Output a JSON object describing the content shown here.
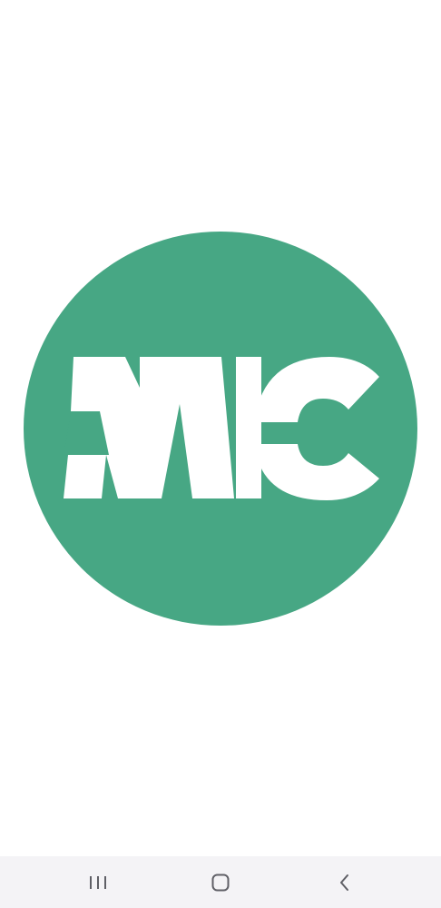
{
  "app": {
    "screen": "splash",
    "logo": {
      "icon": "mc-logo-icon",
      "lettering": "MC",
      "circle_color": "#47a784",
      "letter_color": "#ffffff"
    }
  },
  "navigation_bar": {
    "background": "#f4f3f6",
    "icon_color": "#5f5f66",
    "buttons": [
      {
        "name": "recents",
        "icon": "recents-icon"
      },
      {
        "name": "home",
        "icon": "home-icon"
      },
      {
        "name": "back",
        "icon": "back-icon"
      }
    ]
  }
}
